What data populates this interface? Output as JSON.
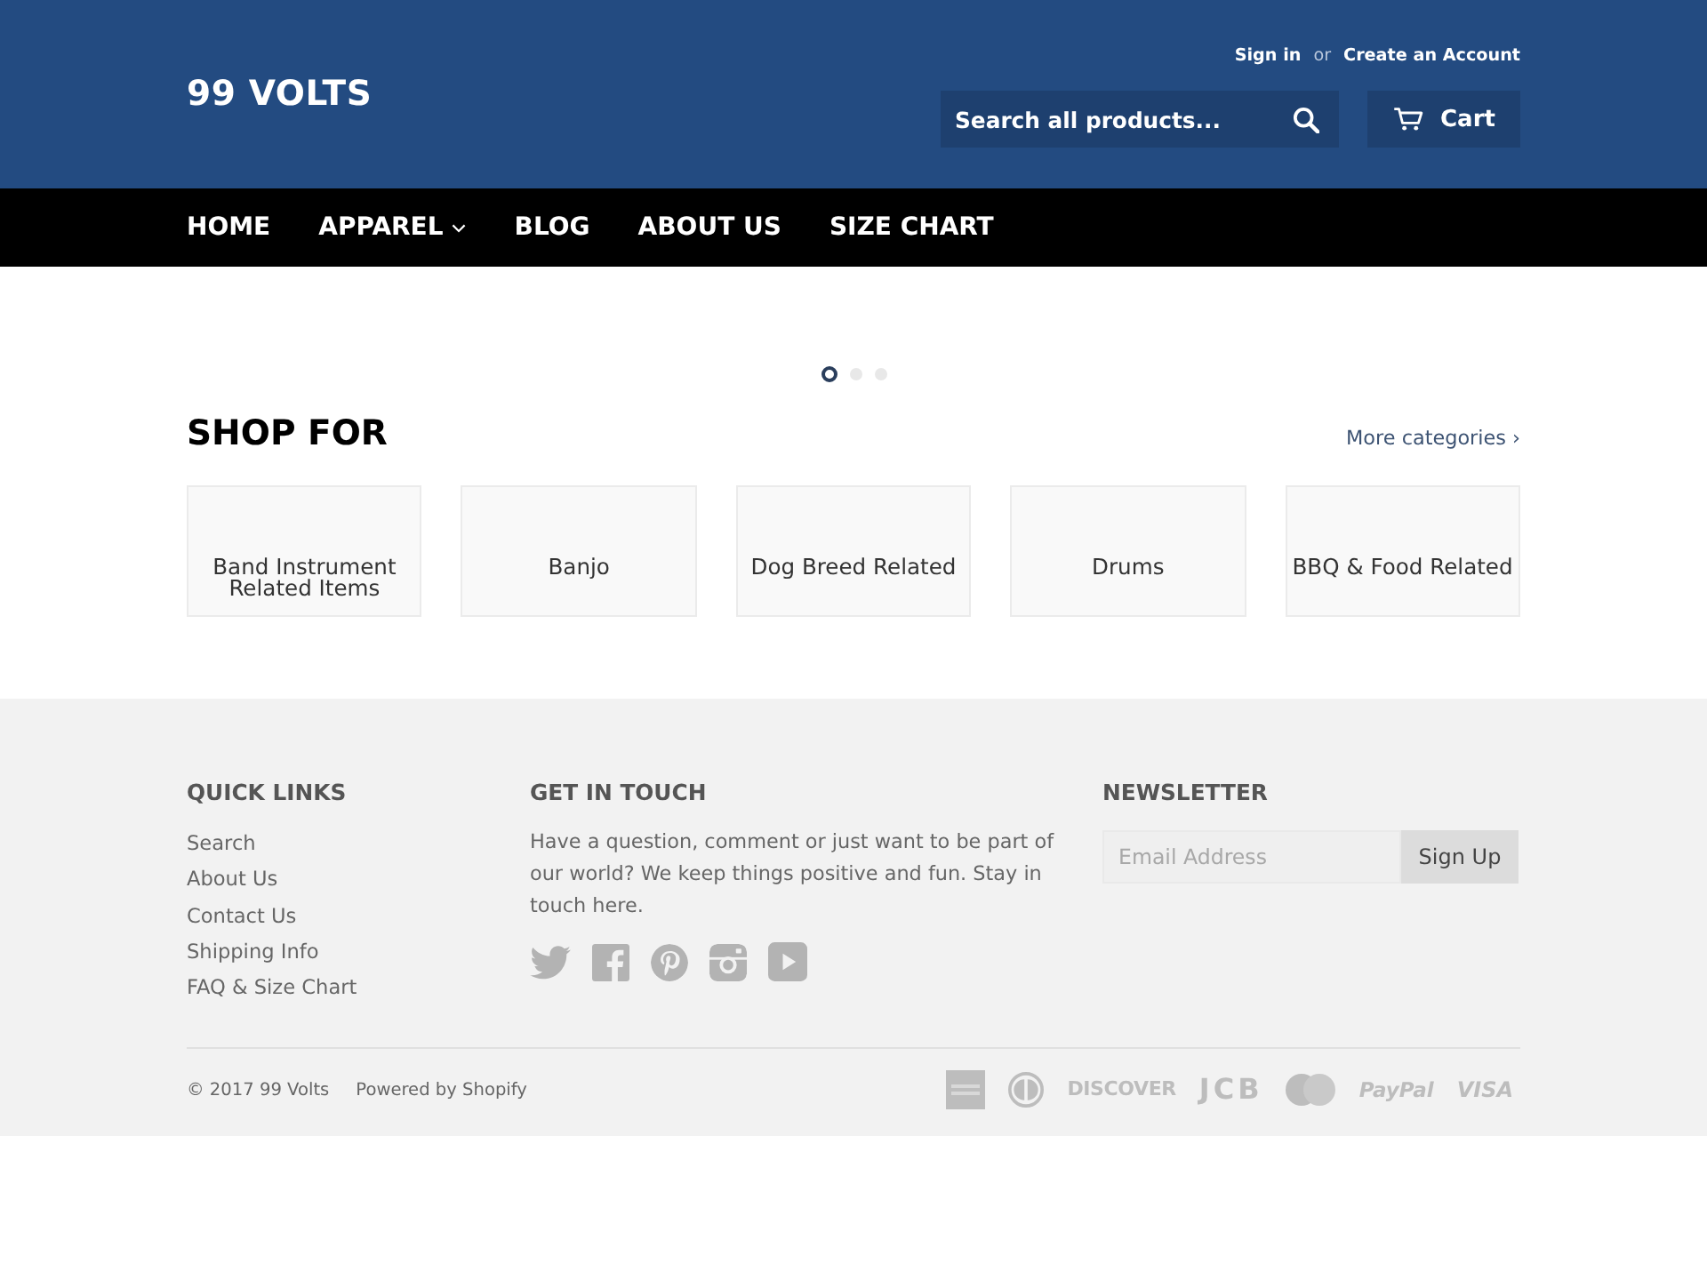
{
  "header": {
    "logo": "99 VOLTS",
    "account": {
      "sign_in": "Sign in",
      "separator": "or",
      "create_account": "Create an Account"
    },
    "search": {
      "placeholder": "Search all products..."
    },
    "cart_button": "Cart"
  },
  "nav": [
    {
      "label": "HOME",
      "has_dropdown": false
    },
    {
      "label": "APPAREL",
      "has_dropdown": true
    },
    {
      "label": "BLOG",
      "has_dropdown": false
    },
    {
      "label": "ABOUT US",
      "has_dropdown": false
    },
    {
      "label": "SIZE CHART",
      "has_dropdown": false
    }
  ],
  "slideshow": {
    "dots": [
      {
        "selected": true
      },
      {
        "selected": false
      },
      {
        "selected": false
      }
    ]
  },
  "shop_for": {
    "title": "SHOP FOR",
    "more_link": "More categories ›",
    "categories": [
      "Band Instrument Related Items",
      "Banjo",
      "Dog Breed Related",
      "Drums",
      "BBQ & Food Related"
    ]
  },
  "footer": {
    "quick_links": {
      "title": "QUICK LINKS",
      "links": [
        "Search",
        "About Us",
        "Contact Us",
        "Shipping Info",
        "FAQ & Size Chart"
      ]
    },
    "get_in_touch": {
      "title": "GET IN TOUCH",
      "text": "Have a question, comment or just want to be part of our world? We keep things positive and fun. Stay in touch here."
    },
    "newsletter": {
      "title": "NEWSLETTER",
      "placeholder": "Email Address",
      "button": "Sign Up"
    },
    "copyright": "© 2017 99 Volts",
    "powered_by": "Powered by Shopify",
    "payment_methods": [
      {
        "kind": "amex"
      },
      {
        "kind": "diners"
      },
      {
        "kind": "discover",
        "text": "DISCOVER"
      },
      {
        "kind": "jcb",
        "text": "JCB"
      },
      {
        "kind": "mastercard"
      },
      {
        "kind": "paypal",
        "text": "PayPal"
      },
      {
        "kind": "visa",
        "text": "VISA"
      }
    ]
  }
}
